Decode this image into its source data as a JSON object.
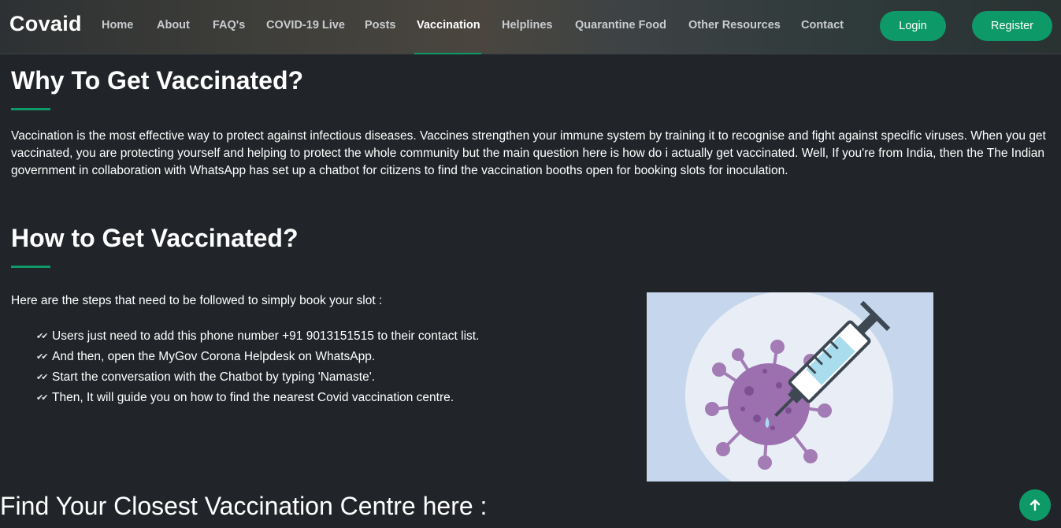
{
  "header": {
    "brand": "Covaid",
    "nav": [
      {
        "label": "Home"
      },
      {
        "label": "About"
      },
      {
        "label": "FAQ's"
      },
      {
        "label": "COVID-19 Live"
      },
      {
        "label": "Posts"
      },
      {
        "label": "Vaccination"
      },
      {
        "label": "Helplines"
      },
      {
        "label": "Quarantine Food"
      },
      {
        "label": "Other Resources"
      },
      {
        "label": "Contact"
      }
    ],
    "active_nav": "Vaccination",
    "login_label": "Login",
    "register_label": "Register"
  },
  "why": {
    "title": "Why To Get Vaccinated?",
    "body": "Vaccination is the most effective way to protect against infectious diseases. Vaccines strengthen your immune system by training it to recognise and fight against specific viruses. When you get vaccinated, you are protecting yourself and helping to protect the whole community but the main question here is how do i actually get vaccinated. Well, If you're from India, then the The Indian government in collaboration with WhatsApp has set up a chatbot for citizens to find the vaccination booths open for booking slots for inoculation."
  },
  "how": {
    "title": "How to Get Vaccinated?",
    "intro": "Here are the steps that need to be followed to simply book your slot :",
    "steps": [
      "Users just need to add this phone number +91 9013151515 to their contact list.",
      "And then, open the MyGov Corona Helpdesk on WhatsApp.",
      "Start the conversation with the Chatbot by typing 'Namaste'.",
      "Then, It will guide you on how to find the nearest Covid vaccination centre."
    ]
  },
  "find": {
    "title": "Find Your Closest Vaccination Centre here :"
  },
  "icons": {
    "step_check": "double-check-icon",
    "scroll_top": "arrow-up-icon",
    "illustration": "syringe-virus-illustration"
  },
  "colors": {
    "background": "#212529",
    "accent": "#0e9a68",
    "text": "#ffffff",
    "nav_text": "#c9cdd0"
  }
}
